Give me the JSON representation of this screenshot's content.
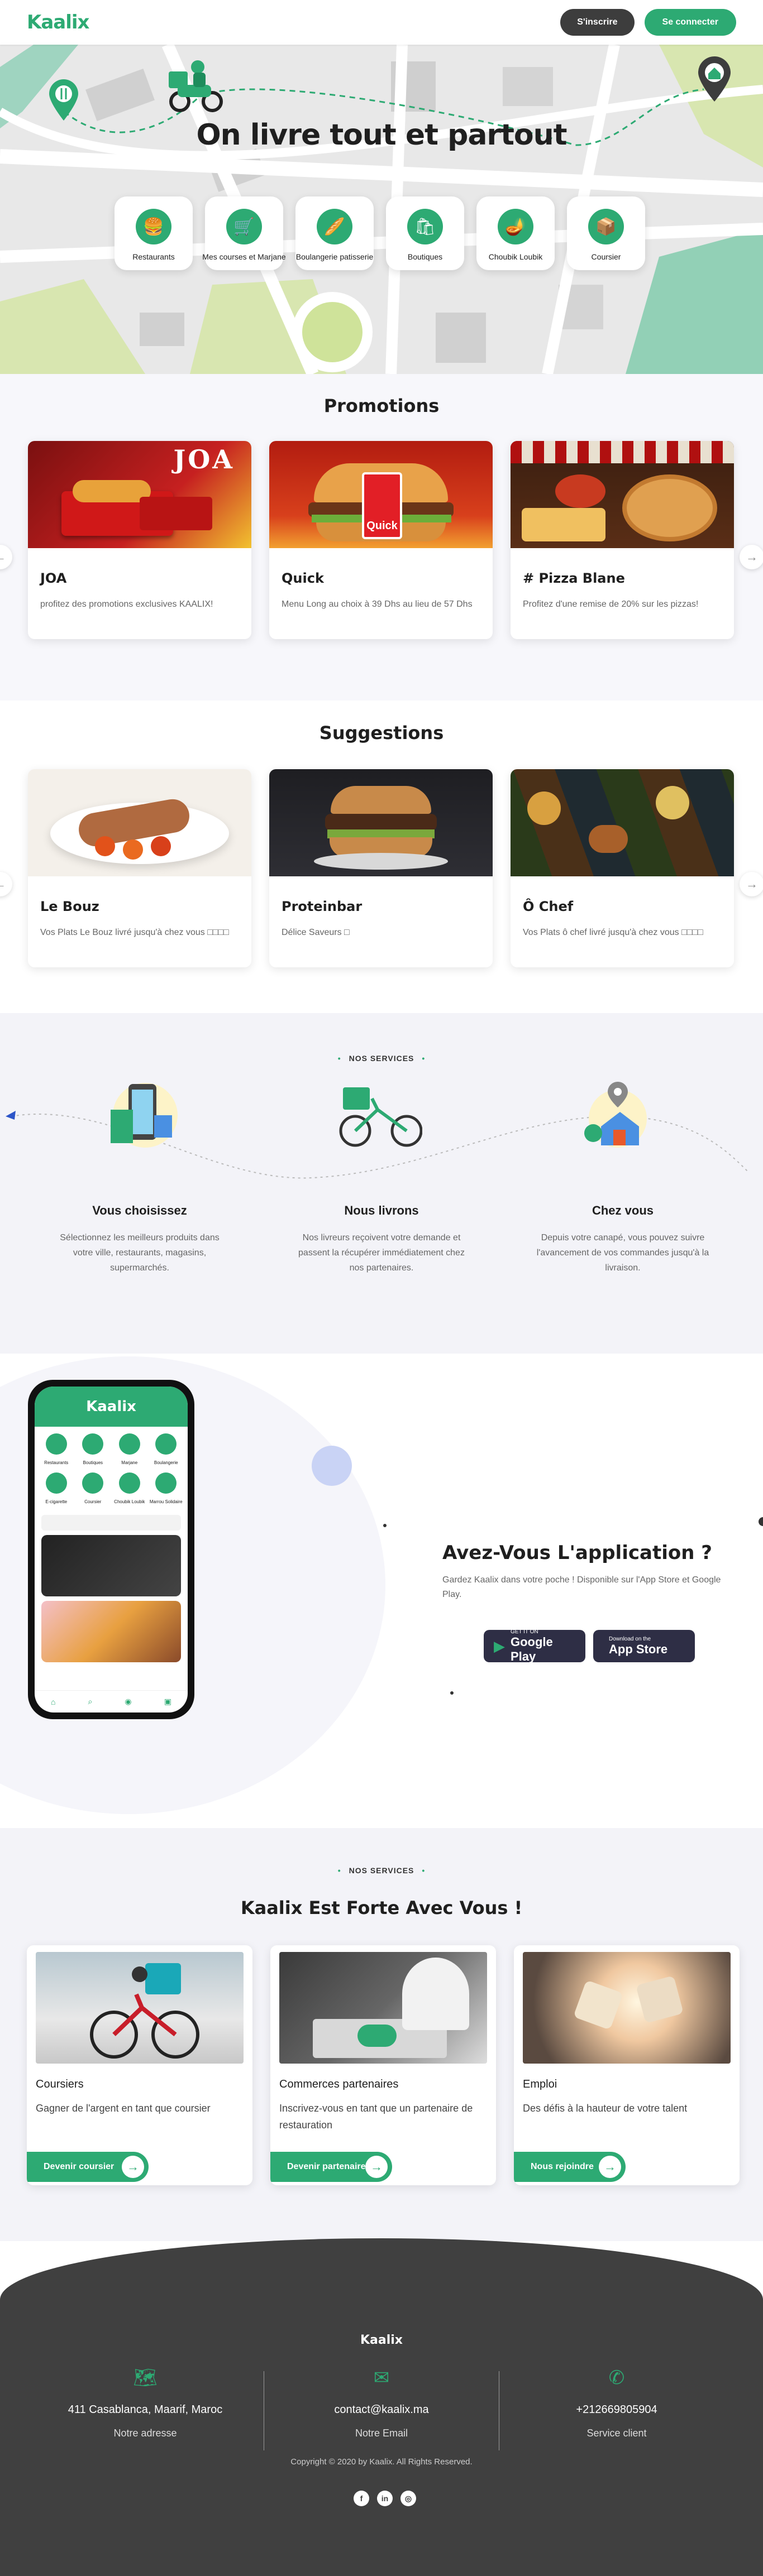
{
  "header": {
    "logo": "Kaalix",
    "signup": "S'inscrire",
    "login": "Se connecter"
  },
  "hero": {
    "title": "On livre tout et partout",
    "categories": [
      {
        "label": "Restaurants",
        "icon": "burger-icon"
      },
      {
        "label": "Mes courses et Marjane",
        "icon": "cart-icon"
      },
      {
        "label": "Boulangerie patisserie",
        "icon": "bread-icon"
      },
      {
        "label": "Boutiques",
        "icon": "shopping-bag-icon"
      },
      {
        "label": "Choubik Loubik",
        "icon": "genie-lamp-icon"
      },
      {
        "label": "Coursier",
        "icon": "package-icon"
      }
    ]
  },
  "promotions": {
    "title": "Promotions",
    "cards": [
      {
        "title": "JOA",
        "desc": "profitez des promotions exclusives KAALIX!"
      },
      {
        "title": "Quick",
        "desc": "Menu Long au choix à 39 Dhs au lieu de 57 Dhs"
      },
      {
        "title": "# Pizza Blane",
        "desc": "Profitez d'une remise de 20% sur les pizzas!"
      }
    ]
  },
  "suggestions": {
    "title": "Suggestions",
    "cards": [
      {
        "title": "Le Bouz",
        "desc": "Vos Plats Le Bouz livré jusqu'à chez vous □□□□"
      },
      {
        "title": "Proteinbar",
        "desc": "Délice Saveurs □"
      },
      {
        "title": "Ô Chef",
        "desc": "Vos Plats ô chef livré jusqu'à chez vous □□□□"
      }
    ]
  },
  "services": {
    "eyebrow": "NOS SERVICES",
    "items": [
      {
        "title": "Vous choisissez",
        "desc": "Sélectionnez les meilleurs produits dans votre ville, restaurants, magasins, supermarchés."
      },
      {
        "title": "Nous livrons",
        "desc": "Nos livreurs reçoivent votre demande et passent la récupérer immédiatement chez nos partenaires."
      },
      {
        "title": "Chez vous",
        "desc": "Depuis votre canapé, vous pouvez suivre l'avancement de vos commandes jusqu'à la livraison."
      }
    ]
  },
  "app": {
    "title": "Avez-Vous L'application ?",
    "desc": "Gardez Kaalix dans votre poche ! Disponible sur l'App Store et Google Play.",
    "google_small": "GET IT ON",
    "google_big": "Google Play",
    "apple_small": "Download on the",
    "apple_big": "App Store",
    "phone_logo": "Kaalix",
    "phone_cats": [
      "Restaurants",
      "Boutiques",
      "Marjane",
      "Boulangerie",
      "E-cigarette",
      "Coursier",
      "Choubik Loubik",
      "Marrou Solidaire"
    ]
  },
  "partners": {
    "eyebrow": "NOS SERVICES",
    "title": "Kaalix Est Forte Avec Vous !",
    "cards": [
      {
        "title": "Coursiers",
        "desc": "Gagner de l'argent en tant que coursier",
        "button": "Devenir coursier"
      },
      {
        "title": "Commerces partenaires",
        "desc": "Inscrivez-vous en tant que un partenaire de restauration",
        "button": "Devenir partenaire"
      },
      {
        "title": "Emploi",
        "desc": "Des défis à la hauteur de votre talent",
        "button": "Nous rejoindre"
      }
    ]
  },
  "footer": {
    "logo": "Kaalix",
    "address": "411 Casablanca, Maarif, Maroc",
    "address_label": "Notre adresse",
    "email": "contact@kaalix.ma",
    "email_label": "Notre Email",
    "phone": "+212669805904",
    "phone_label": "Service client",
    "copyright": "Copyright © 2020 by Kaalix. All Rights Reserved.",
    "socials": [
      "f",
      "in",
      "◎"
    ]
  },
  "colors": {
    "accent": "#2daa73",
    "dark": "#404040"
  }
}
